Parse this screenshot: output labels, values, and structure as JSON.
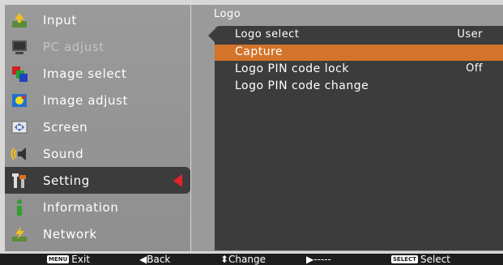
{
  "menu": {
    "items": [
      {
        "label": "Input",
        "icon": "input-icon",
        "disabled": false,
        "selected": false
      },
      {
        "label": "PC adjust",
        "icon": "pc-adjust-icon",
        "disabled": true,
        "selected": false
      },
      {
        "label": "Image select",
        "icon": "image-select-icon",
        "disabled": false,
        "selected": false
      },
      {
        "label": "Image adjust",
        "icon": "image-adjust-icon",
        "disabled": false,
        "selected": false
      },
      {
        "label": "Screen",
        "icon": "screen-icon",
        "disabled": false,
        "selected": false
      },
      {
        "label": "Sound",
        "icon": "sound-icon",
        "disabled": false,
        "selected": false
      },
      {
        "label": "Setting",
        "icon": "setting-icon",
        "disabled": false,
        "selected": true
      },
      {
        "label": "Information",
        "icon": "information-icon",
        "disabled": false,
        "selected": false
      },
      {
        "label": "Network",
        "icon": "network-icon",
        "disabled": false,
        "selected": false
      }
    ]
  },
  "panel": {
    "title": "Logo",
    "items": [
      {
        "label": "Logo select",
        "value": "User"
      },
      {
        "label": "Capture",
        "value": ""
      },
      {
        "label": "Logo PIN code lock",
        "value": "Off"
      },
      {
        "label": "Logo PIN code change",
        "value": ""
      }
    ]
  },
  "bottombar": {
    "exit_key": "MENU",
    "exit_label": "Exit",
    "back_label": "◀Back",
    "change_label": "⬍Change",
    "next_label": "▶-----",
    "select_key": "SELECT",
    "select_label": "Select"
  },
  "colors": {
    "highlight": "#d4742a",
    "selected_arrow": "#e8222a",
    "panel_bg": "#3c3c3c",
    "menu_bg": "#9a9a9a"
  }
}
